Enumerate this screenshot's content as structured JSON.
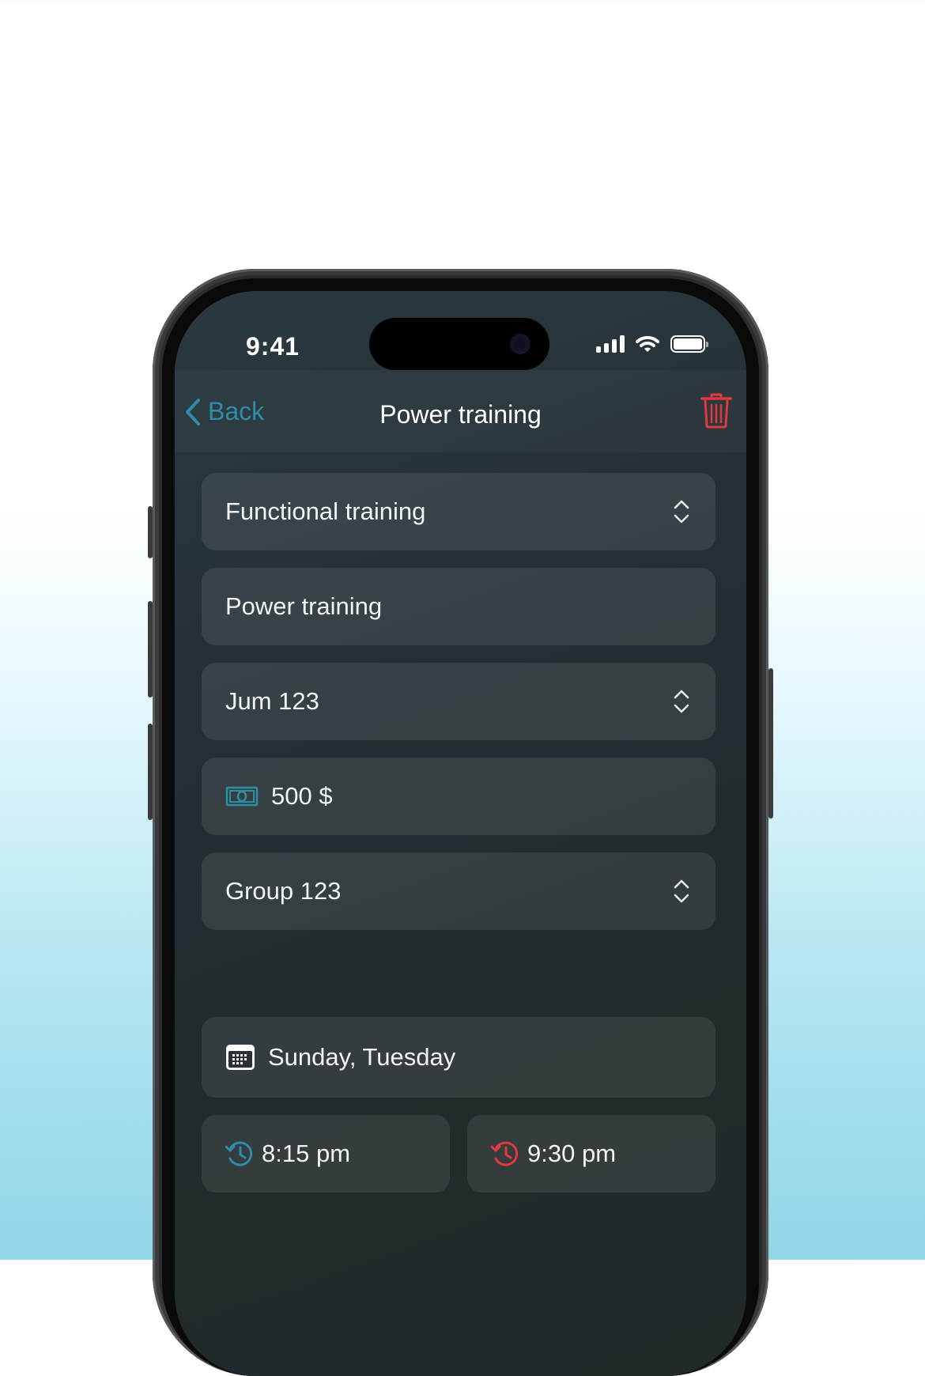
{
  "status_bar": {
    "time": "9:41"
  },
  "nav": {
    "back_label": "Back",
    "title": "Power training"
  },
  "form": {
    "training_type": "Functional training",
    "training_name": "Power training",
    "location": "Jum 123",
    "price": "500 $",
    "group": "Group 123",
    "days": "Sunday, Tuesday",
    "start_time": "8:15 pm",
    "end_time": "9:30 pm"
  },
  "colors": {
    "accent": "#2d8ea8",
    "danger": "#e0393e"
  },
  "icons": {
    "back": "chevron-left-icon",
    "delete": "trash-icon",
    "select": "chevron-up-down-icon",
    "price": "money-icon",
    "days": "calendar-icon",
    "start": "clock-history-icon",
    "end": "clock-history-icon"
  }
}
